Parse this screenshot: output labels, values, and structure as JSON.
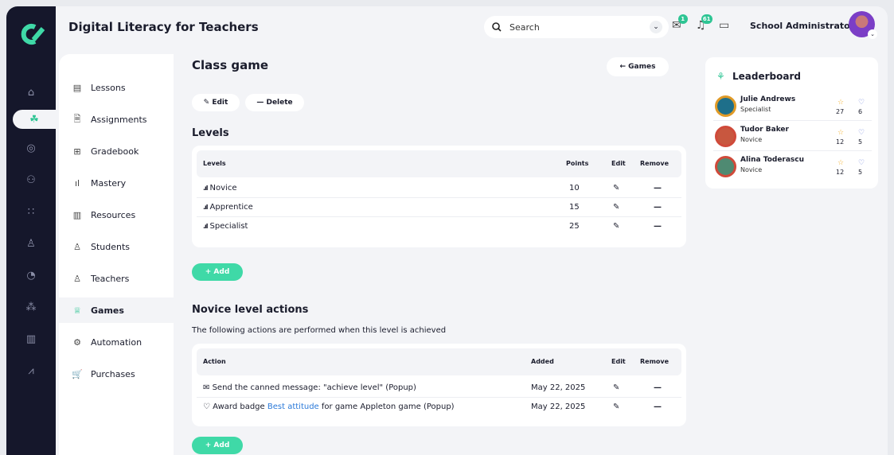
{
  "app": {
    "title": "Digital Literacy for Teachers",
    "logo": "Ƈ"
  },
  "search": {
    "label": "Search"
  },
  "notifications": {
    "messages_count": "1",
    "alerts_count": "61"
  },
  "user": {
    "name": "School Administrator"
  },
  "subnav": [
    {
      "label": "Lessons",
      "icon": "▤"
    },
    {
      "label": "Assignments",
      "icon": "🗎"
    },
    {
      "label": "Gradebook",
      "icon": "⊞"
    },
    {
      "label": "Mastery",
      "icon": "ıl"
    },
    {
      "label": "Resources",
      "icon": "▥"
    },
    {
      "label": "Students",
      "icon": "♙"
    },
    {
      "label": "Teachers",
      "icon": "♙"
    },
    {
      "label": "Games",
      "icon": "♕",
      "active": true
    },
    {
      "label": "Automation",
      "icon": "⚙"
    },
    {
      "label": "Purchases",
      "icon": "🛒"
    }
  ],
  "page": {
    "title": "Class game",
    "back_label": "← Games",
    "edit_label": "✎ Edit",
    "delete_label": "— Delete",
    "levels_heading": "Levels",
    "levels_table": {
      "headers": [
        "Levels",
        "Points",
        "Edit",
        "Remove"
      ],
      "rows": [
        {
          "name": "Novice",
          "points": "10"
        },
        {
          "name": "Apprentice",
          "points": "15"
        },
        {
          "name": "Specialist",
          "points": "25"
        }
      ]
    },
    "add_label": "+ Add",
    "actions_heading": "Novice level actions",
    "actions_desc": "The following actions are performed when this level is achieved",
    "actions_table": {
      "headers": [
        "Action",
        "Added",
        "Edit",
        "Remove"
      ],
      "rows": [
        {
          "text": "Send the canned message: \"achieve level\" (Popup)",
          "added": "May 22, 2025"
        },
        {
          "prefix": "Award badge ",
          "link": "Best attitude",
          "suffix": " for game Appleton game (Popup)",
          "added": "May 22, 2025"
        }
      ]
    }
  },
  "leaderboard": {
    "title": "Leaderboard",
    "entries": [
      {
        "name": "Julie Andrews",
        "rank": "Specialist",
        "stars": "27",
        "badges": "6"
      },
      {
        "name": "Tudor Baker",
        "rank": "Novice",
        "stars": "12",
        "badges": "5"
      },
      {
        "name": "Alina Toderascu",
        "rank": "Novice",
        "stars": "12",
        "badges": "5"
      }
    ]
  },
  "colors": {
    "accent": "#3fd9a7",
    "rail": "#15172b",
    "link": "#2b7ad9"
  }
}
